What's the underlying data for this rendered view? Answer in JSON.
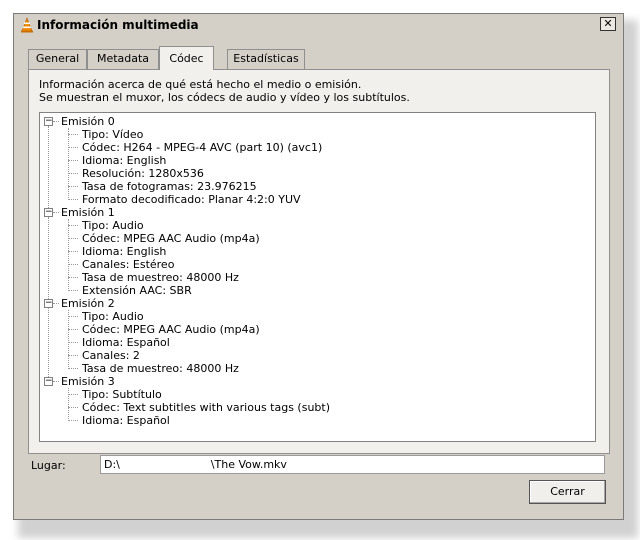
{
  "window": {
    "title": "Información multimedia",
    "close_glyph": "✕"
  },
  "tabs": [
    {
      "label": "General"
    },
    {
      "label": "Metadata"
    },
    {
      "label": "Códec"
    },
    {
      "label": "Estadísticas"
    }
  ],
  "active_tab": 2,
  "description": {
    "line1": "Información acerca de qué está hecho el medio o emisión.",
    "line2": "Se muestran el muxor, los códecs de audio y vídeo y los subtítulos."
  },
  "streams": [
    {
      "label": "Emisión 0",
      "expanded": true,
      "properties": [
        "Tipo: Vídeo",
        "Códec: H264 - MPEG-4 AVC (part 10) (avc1)",
        "Idioma: English",
        "Resolución: 1280x536",
        "Tasa de fotogramas: 23.976215",
        "Formato decodificado: Planar 4:2:0 YUV"
      ]
    },
    {
      "label": "Emisión 1",
      "expanded": true,
      "properties": [
        "Tipo: Audio",
        "Códec: MPEG AAC Audio (mp4a)",
        "Idioma: English",
        "Canales: Estéreo",
        "Tasa de muestreo: 48000 Hz",
        "Extensión AAC: SBR"
      ]
    },
    {
      "label": "Emisión 2",
      "expanded": true,
      "properties": [
        "Tipo: Audio",
        "Códec: MPEG AAC Audio (mp4a)",
        "Idioma: Español",
        "Canales: 2",
        "Tasa de muestreo: 48000 Hz"
      ]
    },
    {
      "label": "Emisión 3",
      "expanded": true,
      "properties": [
        "Tipo: Subtítulo",
        "Códec: Text subtitles with various tags (subt)",
        "Idioma: Español"
      ]
    }
  ],
  "location": {
    "label": "Lugar:",
    "value": "D:\\                          \\The Vow.mkv"
  },
  "buttons": {
    "close": "Cerrar"
  },
  "colors": {
    "window_bg": "#d4d0c8",
    "panel_bg": "#f1f0ec",
    "tree_bg": "#ffffff"
  }
}
